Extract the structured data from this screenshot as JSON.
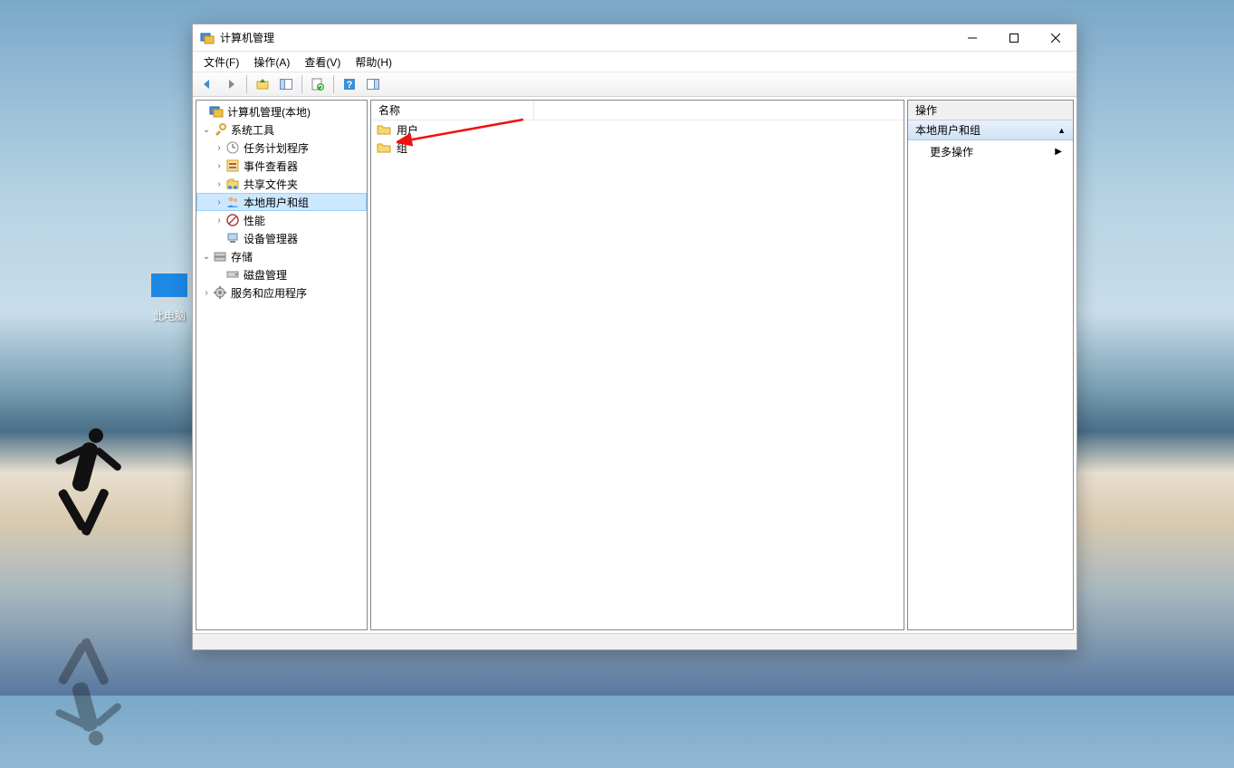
{
  "desktop": {
    "this_pc": "此电脑"
  },
  "window": {
    "title": "计算机管理",
    "menu": {
      "file": "文件(F)",
      "action": "操作(A)",
      "view": "查看(V)",
      "help": "帮助(H)"
    }
  },
  "tree": {
    "root": "计算机管理(本地)",
    "system_tools": "系统工具",
    "task_scheduler": "任务计划程序",
    "event_viewer": "事件查看器",
    "shared_folders": "共享文件夹",
    "local_users_groups": "本地用户和组",
    "performance": "性能",
    "device_manager": "设备管理器",
    "storage": "存储",
    "disk_management": "磁盘管理",
    "services_apps": "服务和应用程序"
  },
  "list": {
    "column_name": "名称",
    "items": [
      {
        "label": "用户"
      },
      {
        "label": "组"
      }
    ]
  },
  "actions": {
    "title": "操作",
    "section": "本地用户和组",
    "more_actions": "更多操作"
  }
}
